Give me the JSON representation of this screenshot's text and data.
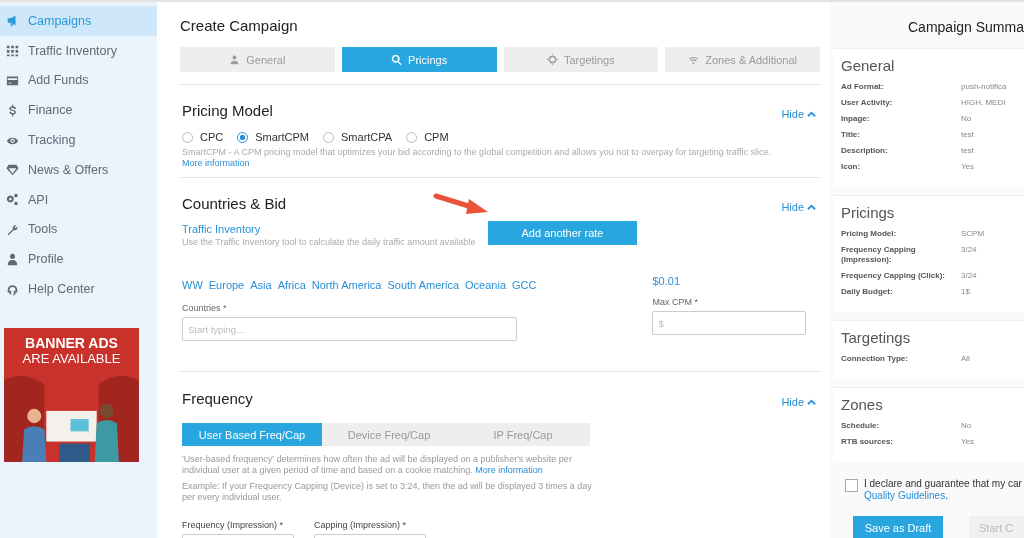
{
  "sidebar": {
    "items": [
      {
        "label": "Campaigns",
        "selected": true
      },
      {
        "label": "Traffic Inventory",
        "selected": false
      },
      {
        "label": "Add Funds",
        "selected": false
      },
      {
        "label": "Finance",
        "selected": false
      },
      {
        "label": "Tracking",
        "selected": false
      },
      {
        "label": "News & Offers",
        "selected": false
      },
      {
        "label": "API",
        "selected": false
      },
      {
        "label": "Tools",
        "selected": false
      },
      {
        "label": "Profile",
        "selected": false
      },
      {
        "label": "Help Center",
        "selected": false
      }
    ],
    "banner": {
      "lines": [
        "BANNER ADS",
        "ARE AVAILABLE"
      ],
      "kind": "picture"
    }
  },
  "main": {
    "title": "Create Campaign",
    "steps": [
      {
        "label": "General",
        "selected": false
      },
      {
        "label": "Pricings",
        "selected": true
      },
      {
        "label": "Targetings",
        "selected": false
      },
      {
        "label": "Zones & Additional",
        "selected": false
      }
    ],
    "pricing": {
      "title": "Pricing Model",
      "hide": "Hide",
      "options": [
        {
          "label": "CPC",
          "selected": false
        },
        {
          "label": "SmartCPM",
          "selected": true
        },
        {
          "label": "SmartCPA",
          "selected": false
        },
        {
          "label": "CPM",
          "selected": false
        }
      ],
      "description": "SmartCPM - A CPM pricing model that optimizes your bid according to the global competition and allows you not to overpay for targeting traffic slice.",
      "link": "More information"
    },
    "countries": {
      "title": "Countries & Bid",
      "hide": "Hide",
      "inventory_link": "Traffic Inventory",
      "inventory_hint": "Use the Traffic Inventory tool to calculate the daily traffic amount available",
      "add_button": "Add another rate",
      "regions": [
        "WW",
        "Europe",
        "Asia",
        "Africa",
        "North America",
        "South America",
        "Oceania",
        "GCC"
      ],
      "price": "$0.01",
      "countries_label": "Countries *",
      "countries_placeholder": "Start typing...",
      "max_label": "Max CPM *",
      "max_placeholder": "$"
    },
    "frequency": {
      "title": "Frequency",
      "hide": "Hide",
      "tabs": [
        {
          "label": "User Based Freq/Cap",
          "selected": true
        },
        {
          "label": "Device Freq/Cap",
          "selected": false
        },
        {
          "label": "IP Freq/Cap",
          "selected": false
        }
      ],
      "description": "'User-based frequency' determines how often the ad will be displayed on a publisher's website per individual user at a given period of time and based on a cookie matching.",
      "link": "More information",
      "example": "Example: If your Frequency Capping (Device) is set to 3:24, then the ad will be displayed 3 times a day per every individual user.",
      "fields": [
        "Frequency (Impression) *",
        "Capping (Impression) *"
      ]
    }
  },
  "summary": {
    "title": "Campaign Summa",
    "sections": [
      {
        "title": "General",
        "rows": [
          {
            "label": "Ad Format:",
            "value": "push-notifica"
          },
          {
            "label": "User Activity:",
            "value": "HIGH, MEDI"
          },
          {
            "label": "Inpage:",
            "value": "No"
          },
          {
            "label": "Title:",
            "value": "test"
          },
          {
            "label": "Description:",
            "value": "test"
          },
          {
            "label": "Icon:",
            "value": "Yes"
          }
        ]
      },
      {
        "title": "Pricings",
        "rows": [
          {
            "label": "Pricing Model:",
            "value": "SCPM"
          },
          {
            "label": "Frequency Capping (Impression):",
            "value": "3/24"
          },
          {
            "label": "Frequency Capping (Click):",
            "value": "3/24"
          },
          {
            "label": "Daily Budget:",
            "value": "1$"
          }
        ]
      },
      {
        "title": "Targetings",
        "rows": [
          {
            "label": "Connection Type:",
            "value": "All"
          }
        ]
      },
      {
        "title": "Zones",
        "rows": [
          {
            "label": "Schedule:",
            "value": "No"
          },
          {
            "label": "RTB sources:",
            "value": "Yes"
          }
        ]
      }
    ],
    "declare": {
      "checked": false,
      "text": "I declare and guarantee that my car",
      "link": "Quality Guidelines",
      "after": "."
    },
    "buttons": [
      "Save as Draft",
      "Start C"
    ]
  }
}
